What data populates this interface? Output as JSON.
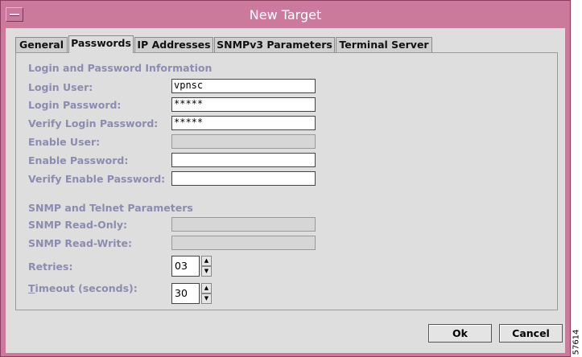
{
  "window": {
    "title": "New Target"
  },
  "tabs": [
    {
      "label": "General",
      "active": false
    },
    {
      "label": "Passwords",
      "active": true
    },
    {
      "label": "IP Addresses",
      "active": false
    },
    {
      "label": "SNMPv3 Parameters",
      "active": false
    },
    {
      "label": "Terminal Server",
      "active": false
    }
  ],
  "login": {
    "section_title": "Login and Password Information",
    "login_user_label": "Login User:",
    "login_user_value": "vpnsc",
    "login_password_label": "Login Password:",
    "login_password_value": "*****",
    "verify_login_password_label": "Verify Login Password:",
    "verify_login_password_value": "*****",
    "enable_user_label": "Enable User:",
    "enable_user_value": "",
    "enable_password_label": "Enable Password:",
    "enable_password_value": "",
    "verify_enable_password_label": "Verify Enable Password:",
    "verify_enable_password_value": ""
  },
  "snmp": {
    "section_title": "SNMP and Telnet Parameters",
    "read_only_label": "SNMP Read-Only:",
    "read_only_value": "",
    "read_write_label": "SNMP Read-Write:",
    "read_write_value": "",
    "retries_label": "Retries:",
    "retries_value": "03",
    "timeout_label_mnemonic": "T",
    "timeout_label_rest": "imeout (seconds):",
    "timeout_value": "30"
  },
  "buttons": {
    "ok": "Ok",
    "cancel": "Cancel"
  },
  "figure_id": "57614",
  "colors": {
    "titlebar": "#cc7a9c",
    "label_disabled": "#8c8cb0",
    "dialog_bg": "#dedede"
  }
}
